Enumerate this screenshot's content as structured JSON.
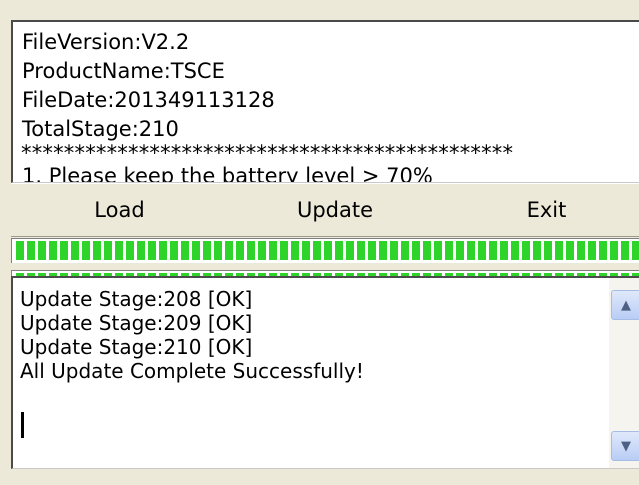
{
  "info": {
    "lines": [
      "FileVersion:V2.2",
      "ProductName:TSCE",
      "FileDate:201349113128",
      "TotalStage:210"
    ],
    "separator": "**********************************************",
    "partial_line": "1. Please keep the battery level > 70%"
  },
  "buttons": {
    "load": "Load",
    "update": "Update",
    "exit": "Exit"
  },
  "progress": {
    "stage_fraction": 1.0,
    "total_fraction": 1.0,
    "color": "#2fd42a"
  },
  "log": {
    "lines": [
      "Update Stage:208 [OK]",
      "Update Stage:209 [OK]",
      "Update Stage:210 [OK]",
      "All Update Complete Successfully!"
    ]
  },
  "icons": {
    "scroll_up": "chevron-up-icon",
    "scroll_down": "chevron-down-icon"
  }
}
